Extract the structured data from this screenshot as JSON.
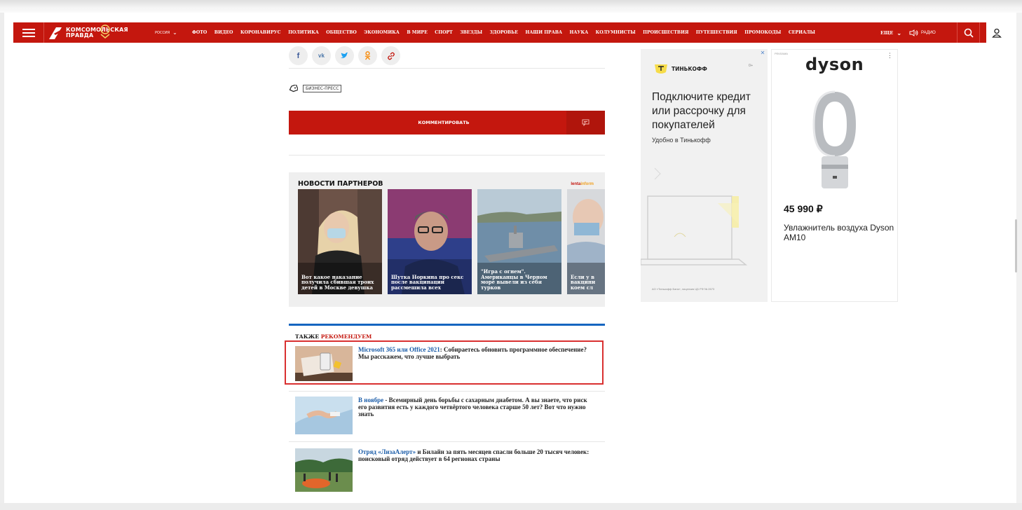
{
  "header": {
    "logo_text_1": "КОМСОМОЛЬСКАЯ",
    "logo_text_2": "ПРАВДА",
    "region": "РОССИЯ",
    "nav_items": [
      "ФОТО",
      "ВИДЕО",
      "КОРОНАВИРУС",
      "ПОЛИТИКА",
      "ОБЩЕСТВО",
      "ЭКОНОМИКА",
      "В МИРЕ",
      "СПОРТ",
      "ЗВЕЗДЫ",
      "ЗДОРОВЬЕ",
      "НАШИ ПРАВА",
      "НАУКА",
      "КОЛУМНИСТЫ",
      "ПРОИСШЕСТВИЯ",
      "ПУТЕШЕСТВИЯ",
      "ПРОМОКОДЫ",
      "СЕРИАЛЫ"
    ],
    "more_label": "ЕЩЕ",
    "radio_label": "РАДИО",
    "icons": [
      "hamburger-menu-icon",
      "logo-icon",
      "chevron-down-icon",
      "speaker-icon",
      "search-icon",
      "user-icon"
    ],
    "accent_color": "#c4170e"
  },
  "social": {
    "buttons": [
      {
        "name": "facebook",
        "glyph": "f",
        "color": "#3b5998"
      },
      {
        "name": "vk",
        "glyph": "vk",
        "color": "#4a76a8"
      },
      {
        "name": "twitter",
        "glyph": "🐦",
        "color": "#1da1f2"
      },
      {
        "name": "odnoklassniki",
        "glyph": "ok",
        "color": "#f7931e"
      },
      {
        "name": "copy-link",
        "glyph": "link",
        "color": "#c4170e"
      }
    ]
  },
  "tags": {
    "tag_1": "БИЗНЕС-ПРЕСС"
  },
  "comment_button": {
    "label": "КОММЕНТИРОВАТЬ"
  },
  "partners": {
    "title": "НОВОСТИ ПАРТНЕРОВ",
    "source_a": "lenta",
    "source_b": "inform",
    "cards": [
      {
        "text": "Вот какое наказание получила сбившая троих детей в Москве девушка"
      },
      {
        "text": "Шутка Норкина про секс после вакцинации рассмешила всех"
      },
      {
        "text": "\"Игра с огнем\". Американцы в Черном море вывели из себя турков"
      },
      {
        "text": "Если у в вакцини коем сл"
      }
    ]
  },
  "recommend": {
    "title_a": "ТАКЖЕ ",
    "title_b": "РЕКОМЕНДУЕМ",
    "items": [
      {
        "link": "Microsoft 365 или Office 2021",
        "rest": ": Собираетесь обновить программное обеспечение? Мы расскажем, что лучше выбрать"
      },
      {
        "link": "В ноябре",
        "rest": " - Всемирный день борьбы с сахарным диабетом. А вы знаете, что риск его развития есть у каждого четвёртого человека старше 50 лет? Вот что нужно знать"
      },
      {
        "link": "Отряд «ЛизаАлерт»",
        "rest": " и Билайн за пять месяцев спасли больше 20 тысяч человек: поисковый отряд действует в 64 регионах страны"
      }
    ]
  },
  "ad_tinkoff": {
    "brand": "ТИНЬКОФФ",
    "age": "0+",
    "headline": "Подключите кредит или рассрочку для покупателей",
    "sub": "Удобно в Тинькофф",
    "legal": "АО «Тинькофф Банк», лицензия ЦБ РФ № 2673"
  },
  "ad_dyson": {
    "label": "РЕКЛАМА",
    "brand": "dyson",
    "price": "45 990 ₽",
    "product": "Увлажнитель воздуха Dyson AM10"
  }
}
